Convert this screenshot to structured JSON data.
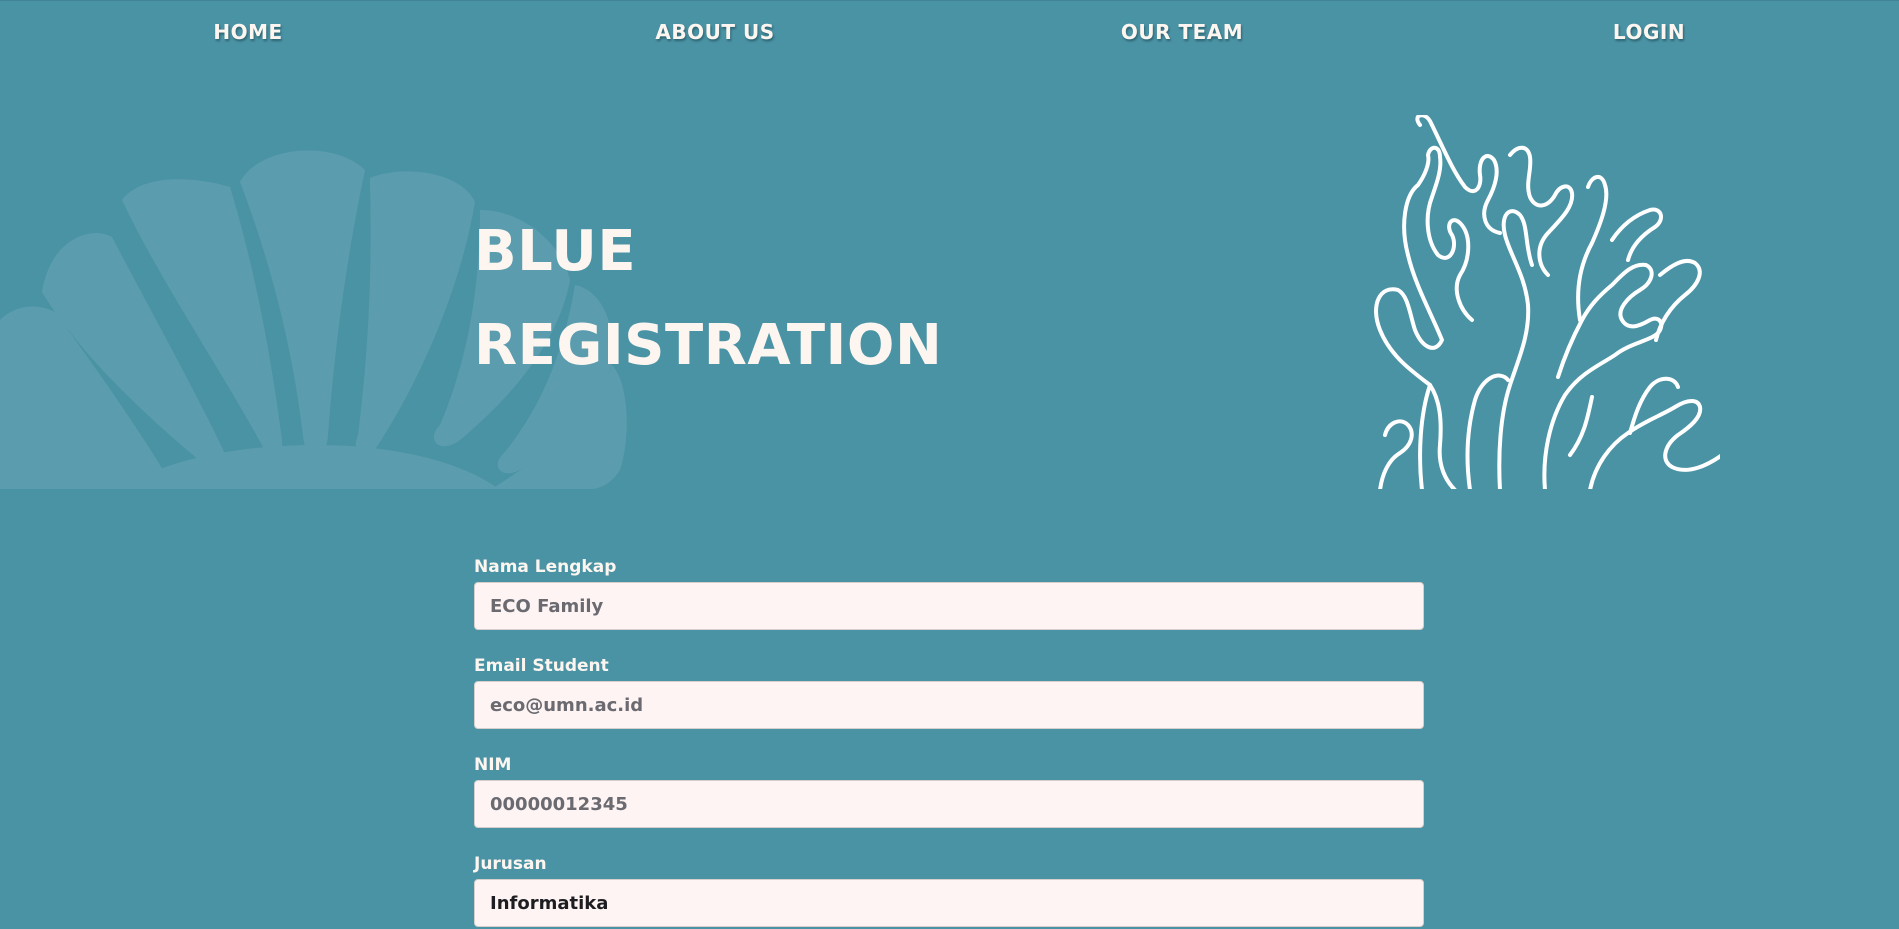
{
  "nav": {
    "items": [
      {
        "label": "HOME"
      },
      {
        "label": "ABOUT US"
      },
      {
        "label": "OUR TEAM"
      },
      {
        "label": "LOGIN"
      }
    ]
  },
  "hero": {
    "title_line1": "BLUE",
    "title_line2": "REGISTRATION"
  },
  "form": {
    "fields": [
      {
        "label": "Nama Lengkap",
        "placeholder": "ECO Family",
        "value": ""
      },
      {
        "label": "Email Student",
        "placeholder": "eco@umn.ac.id",
        "value": ""
      },
      {
        "label": "NIM",
        "placeholder": "00000012345",
        "value": ""
      },
      {
        "label": "Jurusan",
        "placeholder": "",
        "value": "Informatika"
      }
    ]
  },
  "colors": {
    "background": "#4a93a5",
    "text": "#fdf6f0",
    "input_bg": "#fdf4f3",
    "shell": "#5b9dae"
  },
  "icons": {
    "shell": "seashell-illustration",
    "coral": "coral-outline-illustration"
  }
}
